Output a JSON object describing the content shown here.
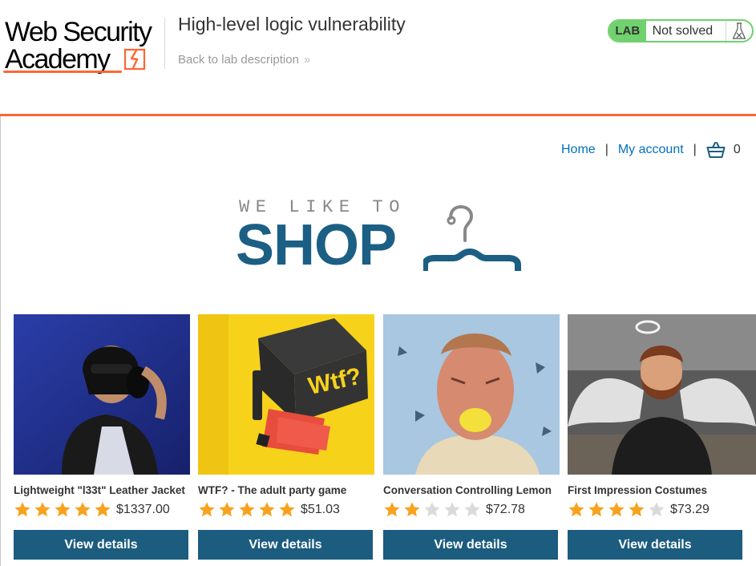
{
  "header": {
    "logo_line1": "Web Security",
    "logo_line2": "Academy",
    "lab_title": "High-level logic vulnerability",
    "back_link": "Back to lab description",
    "lab_badge": "LAB",
    "lab_status": "Not solved",
    "flask_icon": "flask-icon",
    "accent_color": "#ff6633",
    "status_color": "#70d16d"
  },
  "nav": {
    "home": "Home",
    "separator": "|",
    "my_account": "My account",
    "cart_icon": "cart-icon",
    "cart_count": "0"
  },
  "banner": {
    "small_text": "WE LIKE TO",
    "big_text": "SHOP",
    "icon": "hanger-icon",
    "color": "#1c5f84"
  },
  "products": [
    {
      "name": "Lightweight \"l33t\" Leather Jacket",
      "rating": 5,
      "price": "$1337.00",
      "button": "View details"
    },
    {
      "name": "WTF? - The adult party game",
      "rating": 5,
      "price": "$51.03",
      "button": "View details"
    },
    {
      "name": "Conversation Controlling Lemon",
      "rating": 2,
      "price": "$72.78",
      "button": "View details"
    },
    {
      "name": "First Impression Costumes",
      "rating": 4,
      "price": "$73.29",
      "button": "View details"
    }
  ],
  "colors": {
    "star_filled": "#f8a21d",
    "star_empty": "#dadada",
    "button_bg": "#1b5c7f",
    "link": "#0071bc"
  },
  "images": {
    "wtf_box_text": "Wtf?"
  }
}
